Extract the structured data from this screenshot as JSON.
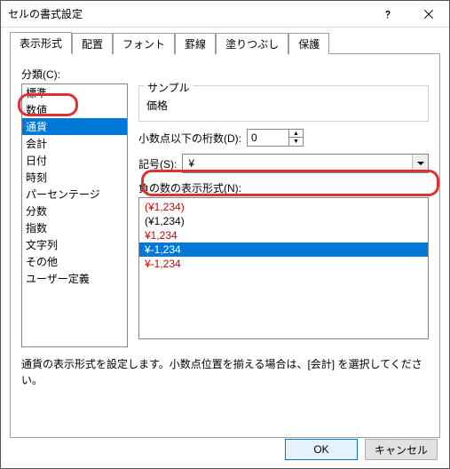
{
  "title": "セルの書式設定",
  "tabs": [
    "表示形式",
    "配置",
    "フォント",
    "罫線",
    "塗りつぶし",
    "保護"
  ],
  "activeTab": 0,
  "categoryLabel": "分類(C):",
  "categories": [
    "標準",
    "数値",
    "通貨",
    "会計",
    "日付",
    "時刻",
    "パーセンテージ",
    "分数",
    "指数",
    "文字列",
    "その他",
    "ユーザー定義"
  ],
  "categorySelected": 2,
  "sample": {
    "label": "サンプル",
    "value": "価格"
  },
  "decimal": {
    "label": "小数点以下の桁数(D):",
    "value": "0"
  },
  "symbol": {
    "label": "記号(S):",
    "value": "¥"
  },
  "negative": {
    "label": "負の数の表示形式(N):",
    "items": [
      {
        "text": "(¥1,234)",
        "cls": "red"
      },
      {
        "text": "(¥1,234)",
        "cls": ""
      },
      {
        "text": "¥1,234",
        "cls": "red"
      },
      {
        "text": "¥-1,234",
        "cls": "hl"
      },
      {
        "text": "¥-1,234",
        "cls": "red"
      }
    ]
  },
  "note": "通貨の表示形式を設定します。小数点位置を揃える場合は、[会計] を選択してください。",
  "buttons": {
    "ok": "OK",
    "cancel": "キャンセル"
  }
}
